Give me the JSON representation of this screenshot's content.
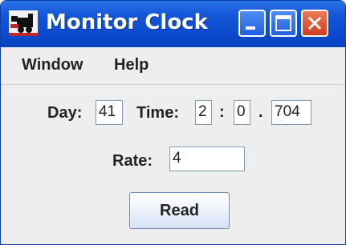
{
  "window": {
    "title": "Monitor Clock",
    "icon": "locomotive-icon",
    "controls": [
      "minimize-icon",
      "maximize-icon",
      "close-icon"
    ]
  },
  "menubar": {
    "items": [
      {
        "label": "Window"
      },
      {
        "label": "Help"
      }
    ]
  },
  "form": {
    "day_label": "Day:",
    "day_value": "41",
    "time_label": "Time:",
    "hours_value": "2",
    "colon": ":",
    "minutes_value": "0",
    "dot": ".",
    "millis_value": "704",
    "rate_label": "Rate:",
    "rate_value": "4"
  },
  "actions": {
    "read_label": "Read"
  },
  "colors": {
    "titlebar": "#0c4bcf",
    "close_button": "#cf3d1f",
    "background": "#eeeeee"
  }
}
